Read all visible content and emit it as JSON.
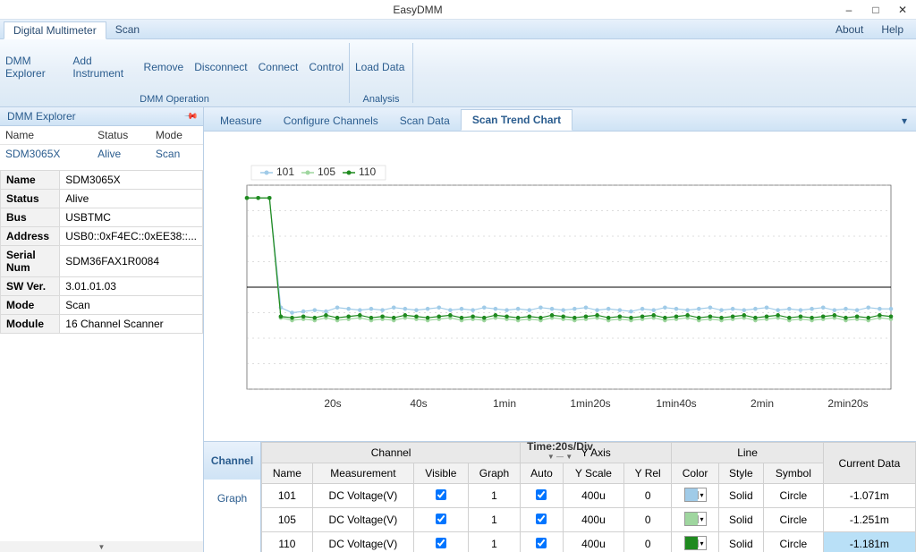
{
  "window": {
    "title": "EasyDMM",
    "about": "About",
    "help": "Help"
  },
  "menu_tabs": [
    "Digital Multimeter",
    "Scan"
  ],
  "active_menu_tab": 0,
  "ribbon": {
    "dmm_group": {
      "label": "DMM Operation",
      "actions": [
        "DMM Explorer",
        "Add Instrument",
        "Remove",
        "Disconnect",
        "Connect",
        "Control"
      ]
    },
    "analysis_group": {
      "label": "Analysis",
      "actions": [
        "Load Data"
      ]
    }
  },
  "explorer": {
    "title": "DMM Explorer",
    "columns": [
      "Name",
      "Status",
      "Mode"
    ],
    "rows": [
      {
        "name": "SDM3065X",
        "status": "Alive",
        "mode": "Scan"
      }
    ],
    "props": [
      [
        "Name",
        "SDM3065X"
      ],
      [
        "Status",
        "Alive"
      ],
      [
        "Bus",
        "USBTMC"
      ],
      [
        "Address",
        "USB0::0xF4EC::0xEE38::..."
      ],
      [
        "Serial Num",
        "SDM36FAX1R0084"
      ],
      [
        "SW Ver.",
        "3.01.01.03"
      ],
      [
        "Mode",
        "Scan"
      ],
      [
        "Module",
        "16 Channel Scanner"
      ]
    ]
  },
  "tabs": {
    "items": [
      "Measure",
      "Configure Channels",
      "Scan Data",
      "Scan Trend Chart"
    ],
    "active": 3
  },
  "chart_data": {
    "type": "line",
    "title": "",
    "xlabel": "Time:20s/Div",
    "ylabel": "",
    "x_ticks": [
      "20s",
      "40s",
      "1min",
      "1min20s",
      "1min40s",
      "2min",
      "2min20s"
    ],
    "series": [
      {
        "name": "101",
        "color": "#a0cbe8",
        "values": [
          350,
          350,
          350,
          -80,
          -100,
          -95,
          -90,
          -95,
          -80,
          -85,
          -90,
          -85,
          -90,
          -80,
          -85,
          -90,
          -85,
          -80,
          -90,
          -85,
          -90,
          -80,
          -85,
          -90,
          -85,
          -90,
          -80,
          -85,
          -90,
          -85,
          -80,
          -90,
          -85,
          -90,
          -95,
          -85,
          -90,
          -80,
          -85,
          -90,
          -85,
          -80,
          -90,
          -85,
          -90,
          -85,
          -80,
          -90,
          -85,
          -90,
          -85,
          -80,
          -90,
          -85,
          -90,
          -80,
          -85,
          -85
        ]
      },
      {
        "name": "105",
        "color": "#9fd69f",
        "values": [
          350,
          350,
          350,
          -120,
          -130,
          -125,
          -130,
          -120,
          -130,
          -125,
          -120,
          -130,
          -125,
          -130,
          -120,
          -125,
          -130,
          -125,
          -120,
          -130,
          -125,
          -130,
          -120,
          -125,
          -130,
          -125,
          -130,
          -120,
          -125,
          -130,
          -125,
          -120,
          -130,
          -125,
          -130,
          -125,
          -120,
          -130,
          -125,
          -120,
          -130,
          -125,
          -130,
          -125,
          -120,
          -130,
          -125,
          -120,
          -130,
          -125,
          -130,
          -125,
          -120,
          -130,
          -125,
          -130,
          -120,
          -125
        ]
      },
      {
        "name": "110",
        "color": "#1f8a1f",
        "values": [
          350,
          350,
          350,
          -115,
          -120,
          -115,
          -120,
          -110,
          -120,
          -115,
          -110,
          -120,
          -115,
          -120,
          -110,
          -115,
          -120,
          -115,
          -110,
          -120,
          -115,
          -120,
          -110,
          -115,
          -120,
          -115,
          -120,
          -110,
          -115,
          -120,
          -115,
          -110,
          -120,
          -115,
          -120,
          -115,
          -110,
          -120,
          -115,
          -110,
          -120,
          -115,
          -120,
          -115,
          -110,
          -120,
          -115,
          -110,
          -120,
          -115,
          -120,
          -115,
          -110,
          -120,
          -115,
          -120,
          -110,
          -115
        ]
      }
    ],
    "y_range": [
      -400,
      400
    ],
    "grid": true
  },
  "channel_sidetabs": [
    "Channel",
    "Graph"
  ],
  "channel_table": {
    "groups": [
      "Channel",
      "Y Axis",
      "Line",
      "Current Data"
    ],
    "headers": [
      "Name",
      "Measurement",
      "Visible",
      "Graph",
      "Auto",
      "Y Scale",
      "Y Rel",
      "Color",
      "Style",
      "Symbol"
    ],
    "rows": [
      {
        "name": "101",
        "meas": "DC Voltage(V)",
        "visible": true,
        "graph": "1",
        "auto": true,
        "yscale": "400u",
        "yrel": "0",
        "color": "#a0cbe8",
        "style": "Solid",
        "symbol": "Circle",
        "current": "-1.071m"
      },
      {
        "name": "105",
        "meas": "DC Voltage(V)",
        "visible": true,
        "graph": "1",
        "auto": true,
        "yscale": "400u",
        "yrel": "0",
        "color": "#9fd69f",
        "style": "Solid",
        "symbol": "Circle",
        "current": "-1.251m"
      },
      {
        "name": "110",
        "meas": "DC Voltage(V)",
        "visible": true,
        "graph": "1",
        "auto": true,
        "yscale": "400u",
        "yrel": "0",
        "color": "#1f8a1f",
        "style": "Solid",
        "symbol": "Circle",
        "current": "-1.181m"
      }
    ],
    "highlight_row": 2
  }
}
